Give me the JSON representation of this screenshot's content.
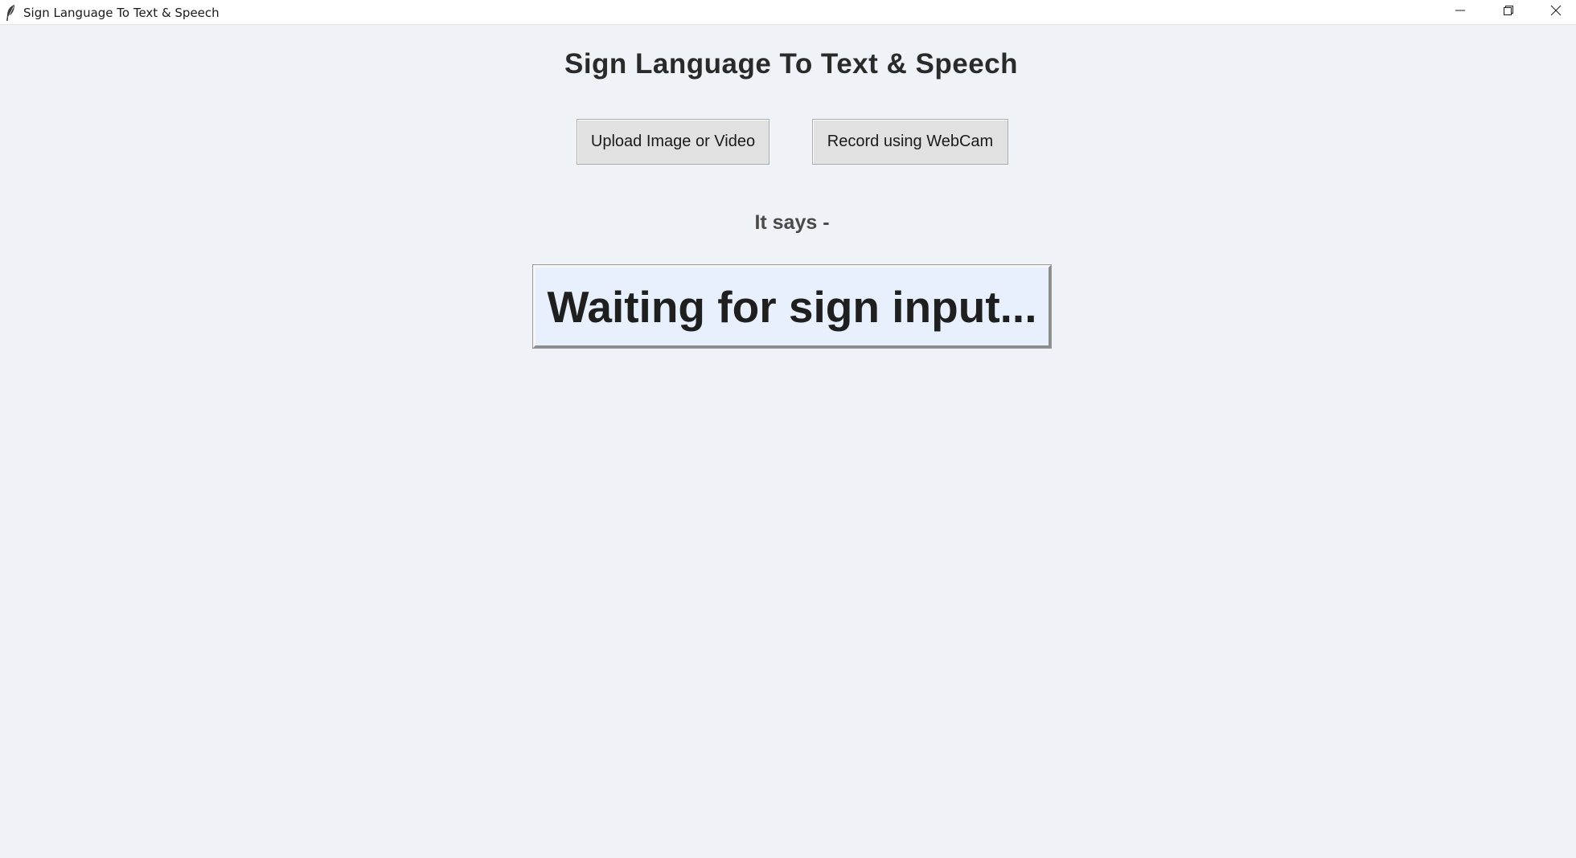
{
  "window": {
    "title": "Sign Language To Text & Speech",
    "controls": {
      "minimize_icon": "minimize-icon",
      "maximize_icon": "restore-icon",
      "close_icon": "close-icon"
    },
    "app_icon": "feather-icon"
  },
  "main": {
    "heading": "Sign Language To Text & Speech",
    "buttons": {
      "upload_label": "Upload Image or Video",
      "webcam_label": "Record using WebCam"
    },
    "result_label": "It says -",
    "result_text": "Waiting for sign input..."
  },
  "colors": {
    "background": "#eff3f7",
    "output_background": "#e7f0fc",
    "button_background": "#e1e1e1"
  }
}
